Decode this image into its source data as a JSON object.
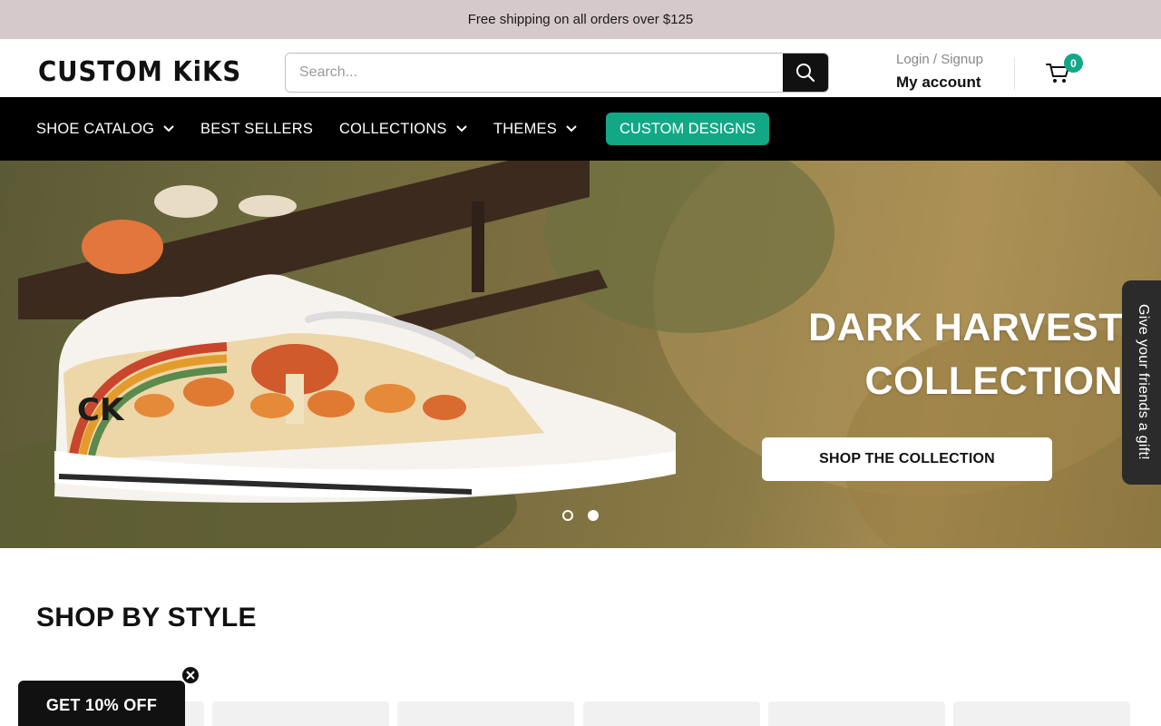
{
  "announcement": "Free shipping on all orders over $125",
  "brand": {
    "logo_text": "CUSTOM KiKS"
  },
  "search": {
    "placeholder": "Search..."
  },
  "account": {
    "login_label": "Login / Signup",
    "account_label": "My account"
  },
  "cart": {
    "count": "0"
  },
  "nav": {
    "items": [
      {
        "label": "SHOE CATALOG",
        "has_dropdown": true
      },
      {
        "label": "BEST SELLERS",
        "has_dropdown": false
      },
      {
        "label": "COLLECTIONS",
        "has_dropdown": true
      },
      {
        "label": "THEMES",
        "has_dropdown": true
      }
    ],
    "cta": "CUSTOM DESIGNS"
  },
  "hero": {
    "title_line1": "DARK HARVEST",
    "title_line2": "COLLECTION",
    "button": "SHOP THE COLLECTION",
    "shoe_mark": "CK",
    "slides_total": 2,
    "active_slide": 1
  },
  "gift_tab": "Give your friends a gift!",
  "section": {
    "title": "SHOP BY STYLE"
  },
  "promo": {
    "label": "GET 10% OFF"
  },
  "colors": {
    "accent": "#12a886",
    "announcement_bg": "#d6c9cb",
    "nav_bg": "#000000"
  }
}
